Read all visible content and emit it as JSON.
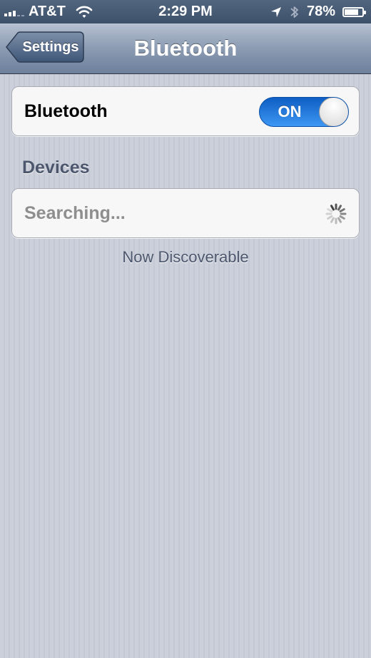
{
  "status_bar": {
    "carrier": "AT&T",
    "time": "2:29 PM",
    "battery": "78%",
    "battery_level": 0.78,
    "signal_bars": 3,
    "icons": [
      "signal-bars-icon",
      "wifi-icon",
      "location-arrow-icon",
      "bluetooth-icon",
      "battery-icon"
    ]
  },
  "nav": {
    "back_label": "Settings",
    "title": "Bluetooth"
  },
  "bluetooth_toggle": {
    "label": "Bluetooth",
    "state_label": "ON",
    "on": true,
    "color": "#1a73e0"
  },
  "devices": {
    "header": "Devices",
    "status": "Searching...",
    "spinner": "activity-spinner-icon"
  },
  "footer": "Now Discoverable"
}
